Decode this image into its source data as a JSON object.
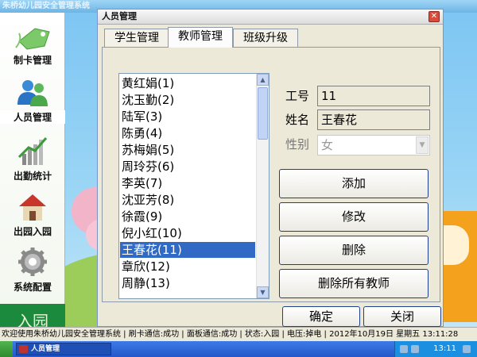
{
  "app": {
    "title": "朱桥幼儿园安全管理系统"
  },
  "sidebar": {
    "items": [
      {
        "label": "制卡管理",
        "icon": "card-tag-icon"
      },
      {
        "label": "人员管理",
        "icon": "people-icon"
      },
      {
        "label": "出勤统计",
        "icon": "bar-chart-icon"
      },
      {
        "label": "出园入园",
        "icon": "house-icon"
      },
      {
        "label": "系统配置",
        "icon": "gear-icon"
      }
    ],
    "bottom_button": "入园"
  },
  "dialog": {
    "title": "人员管理",
    "tabs": [
      {
        "label": "学生管理",
        "active": false
      },
      {
        "label": "教师管理",
        "active": true
      },
      {
        "label": "班级升级",
        "active": false
      }
    ],
    "teacher_list": [
      "黄红娟(1)",
      "沈玉勤(2)",
      "陆军(3)",
      "陈勇(4)",
      "苏梅娟(5)",
      "周玲芬(6)",
      "李英(7)",
      "沈亚芳(8)",
      "徐霞(9)",
      "倪小红(10)",
      "王春花(11)",
      "章欣(12)",
      "周静(13)"
    ],
    "selected_index": 10,
    "form": {
      "id_label": "工号",
      "id_value": "11",
      "name_label": "姓名",
      "name_value": "王春花",
      "gender_label": "性别",
      "gender_value": "女"
    },
    "actions": {
      "add": "添加",
      "edit": "修改",
      "delete": "删除",
      "delete_all": "删除所有教师"
    },
    "ok_label": "确定",
    "close_label": "关闭"
  },
  "statusbar": {
    "text": "欢迎使用朱桥幼儿园安全管理系统 | 刷卡通信:成功 | 面板通信:成功 | 状态:入园 | 电压:掉电 | 2012年10月19日 星期五 13:11:28"
  },
  "taskbar": {
    "item_label": "人员管理",
    "time": "13:11"
  },
  "colors": {
    "selection": "#316ac5",
    "sidebar_accent": "#1c8a3c",
    "taskbar": "#2457c9"
  }
}
